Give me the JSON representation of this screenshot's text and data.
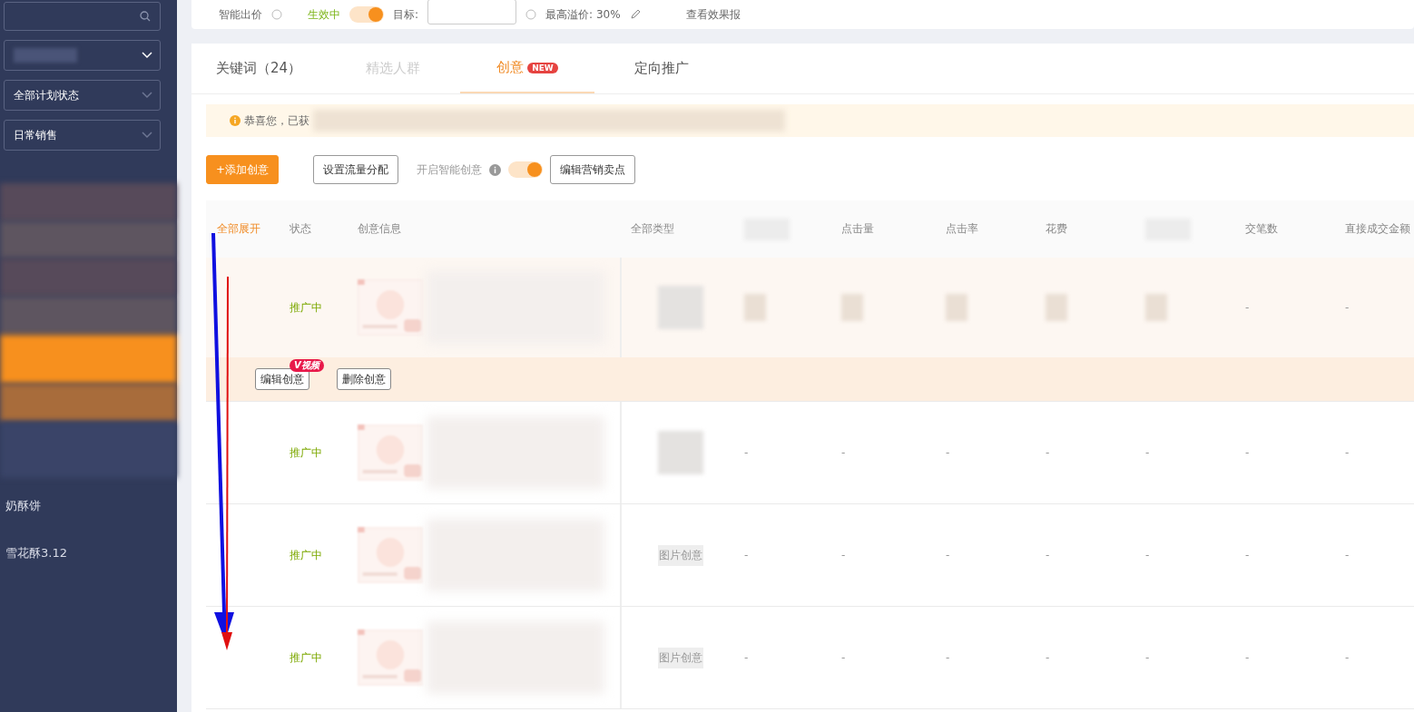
{
  "sidebar": {
    "filters": [
      {
        "label": "全部计划状态"
      },
      {
        "label": "日常销售"
      }
    ],
    "items": [
      {
        "label": "奶酥饼"
      },
      {
        "label": "雪花酥3.12"
      }
    ]
  },
  "top_bar": {
    "bid_label": "智能出价",
    "bid_status": "生效中",
    "bid_on": true,
    "target_label": "目标:",
    "max_premium": "最高溢价: 30%",
    "report_link": "查看效果报"
  },
  "tabs": [
    {
      "label": "关键词（24）",
      "selected": false
    },
    {
      "label": "精选人群",
      "selected": false
    },
    {
      "label": "创意",
      "badge": "NEW",
      "selected": true
    },
    {
      "label": "定向推广",
      "selected": false
    }
  ],
  "notice": "恭喜您，已获",
  "toolbar": {
    "add_button": "+添加创意",
    "traffic_button": "设置流量分配",
    "smart_label": "开启智能创意",
    "smart_on": true,
    "selling_button": "编辑营销卖点"
  },
  "table": {
    "columns": [
      {
        "kind": "toggle",
        "label": "全部展开"
      },
      {
        "kind": "text",
        "label": "状态"
      },
      {
        "kind": "text",
        "label": "创意信息"
      },
      {
        "kind": "text",
        "label": "全部类型"
      },
      {
        "kind": "redacted"
      },
      {
        "kind": "text",
        "label": "点击量"
      },
      {
        "kind": "text",
        "label": "点击率"
      },
      {
        "kind": "text",
        "label": "花费"
      },
      {
        "kind": "redacted"
      },
      {
        "kind": "text",
        "label": "交笔数"
      },
      {
        "kind": "text",
        "label": "直接成交金额"
      }
    ],
    "rows": [
      {
        "status": "推广中",
        "expanded": true,
        "metrics": [
          {
            "kind": "redacted"
          },
          {
            "kind": "redacted"
          },
          {
            "kind": "redacted"
          },
          {
            "kind": "redacted"
          },
          {
            "kind": "redacted"
          },
          "-",
          "-"
        ],
        "actions": [
          {
            "label": "编辑创意",
            "badge": "V视频"
          },
          {
            "label": "删除创意"
          }
        ]
      },
      {
        "status": "推广中",
        "expanded": false,
        "metrics": [
          "-",
          "-",
          "-",
          "-",
          "-",
          "-",
          "-"
        ]
      },
      {
        "status": "推广中",
        "expanded": false,
        "type": "图片创意",
        "metrics": [
          "-",
          "-",
          "-",
          "-",
          "-",
          "-",
          "-"
        ]
      },
      {
        "status": "推广中",
        "expanded": false,
        "type": "图片创意",
        "metrics": [
          "-",
          "-",
          "-",
          "-",
          "-",
          "-",
          "-"
        ]
      }
    ]
  }
}
